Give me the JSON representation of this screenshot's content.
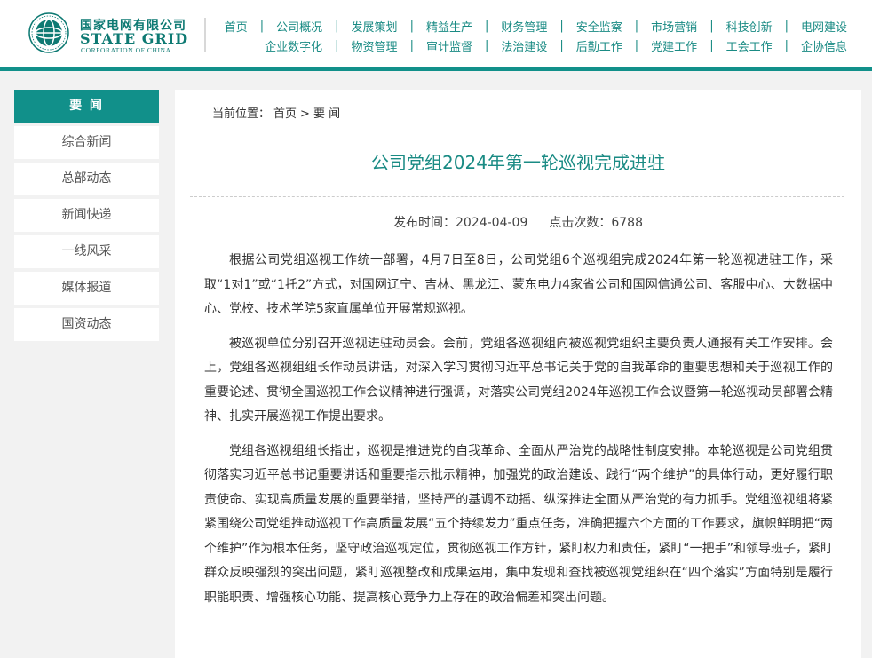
{
  "brand": {
    "cn_name": "国家电网有限公司",
    "en_name": "STATE GRID",
    "en_sub": "CORPORATION OF CHINA"
  },
  "colors": {
    "accent": "#11908a",
    "link": "#1a8b84",
    "background": "#f2f2f2"
  },
  "nav": {
    "row1": [
      "首页",
      "公司概况",
      "发展策划",
      "精益生产",
      "财务管理",
      "安全监察",
      "市场营销",
      "科技创新",
      "电网建设"
    ],
    "row2": [
      "企业数字化",
      "物资管理",
      "审计监督",
      "法治建设",
      "后勤工作",
      "党建工作",
      "工会工作",
      "企协信息"
    ]
  },
  "sidebar": {
    "items": [
      {
        "label": "要 闻",
        "active": true
      },
      {
        "label": "综合新闻"
      },
      {
        "label": "总部动态"
      },
      {
        "label": "新闻快递"
      },
      {
        "label": "一线风采"
      },
      {
        "label": "媒体报道"
      },
      {
        "label": "国资动态"
      }
    ]
  },
  "breadcrumb": {
    "prefix": "当前位置：",
    "home": "首页",
    "sep": ">",
    "current": "要 闻"
  },
  "article": {
    "title": "公司党组2024年第一轮巡视完成进驻",
    "publish_label": "发布时间：",
    "publish_date": "2024-04-09",
    "clicks_label": "点击次数：",
    "clicks": "6788",
    "paragraphs": [
      "根据公司党组巡视工作统一部署，4月7日至8日，公司党组6个巡视组完成2024年第一轮巡视进驻工作，采取“1对1”或“1托2”方式，对国网辽宁、吉林、黑龙江、蒙东电力4家省公司和国网信通公司、客服中心、大数据中心、党校、技术学院5家直属单位开展常规巡视。",
      "被巡视单位分别召开巡视进驻动员会。会前，党组各巡视组向被巡视党组织主要负责人通报有关工作安排。会上，党组各巡视组组长作动员讲话，对深入学习贯彻习近平总书记关于党的自我革命的重要思想和关于巡视工作的重要论述、贯彻全国巡视工作会议精神进行强调，对落实公司党组2024年巡视工作会议暨第一轮巡视动员部署会精神、扎实开展巡视工作提出要求。",
      "党组各巡视组组长指出，巡视是推进党的自我革命、全面从严治党的战略性制度安排。本轮巡视是公司党组贯彻落实习近平总书记重要讲话和重要指示批示精神，加强党的政治建设、践行“两个维护”的具体行动，更好履行职责使命、实现高质量发展的重要举措，坚持严的基调不动摇、纵深推进全面从严治党的有力抓手。党组巡视组将紧紧围绕公司党组推动巡视工作高质量发展“五个持续发力”重点任务，准确把握六个方面的工作要求，旗帜鲜明把“两个维护”作为根本任务，坚守政治巡视定位，贯彻巡视工作方针，紧盯权力和责任，紧盯“一把手”和领导班子，紧盯群众反映强烈的突出问题，紧盯巡视整改和成果运用，集中发现和查找被巡视党组织在“四个落实”方面特别是履行职能职责、增强核心功能、提高核心竞争力上存在的政治偏差和突出问题。"
    ]
  }
}
